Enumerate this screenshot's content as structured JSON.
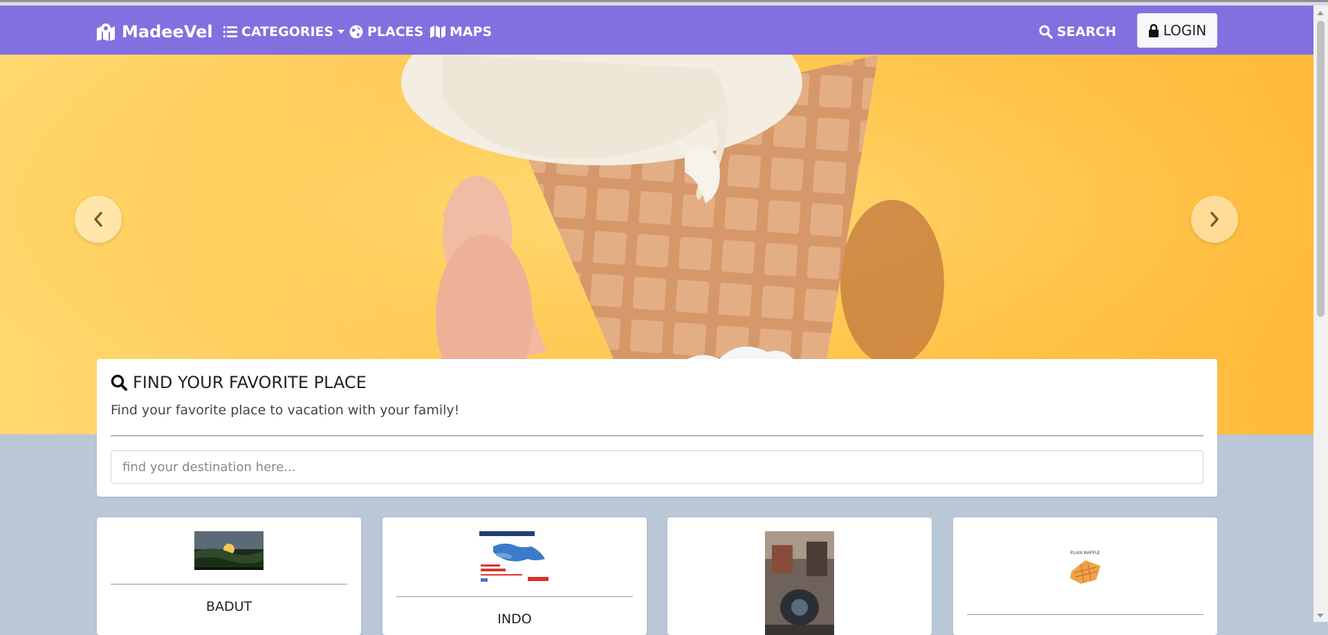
{
  "nav": {
    "brand": "MadeeVel",
    "categories": "CATEGORIES",
    "places": "PLACES",
    "maps": "MAPS",
    "search": "SEARCH",
    "login": "LOGIN"
  },
  "hero": {
    "prev_icon": "chevron-left-icon",
    "next_icon": "chevron-right-icon"
  },
  "search": {
    "title": "FIND YOUR FAVORITE PLACE",
    "subtitle": "Find your favorite place to vacation with your family!",
    "placeholder": "find your destination here..."
  },
  "cards": [
    {
      "title": "BADUT"
    },
    {
      "title": "INDO"
    },
    {
      "title": ""
    },
    {
      "title": ""
    }
  ],
  "colors": {
    "navbar": "#8370e0",
    "background": "#b9c7d6",
    "hero": "#ffc44a"
  }
}
